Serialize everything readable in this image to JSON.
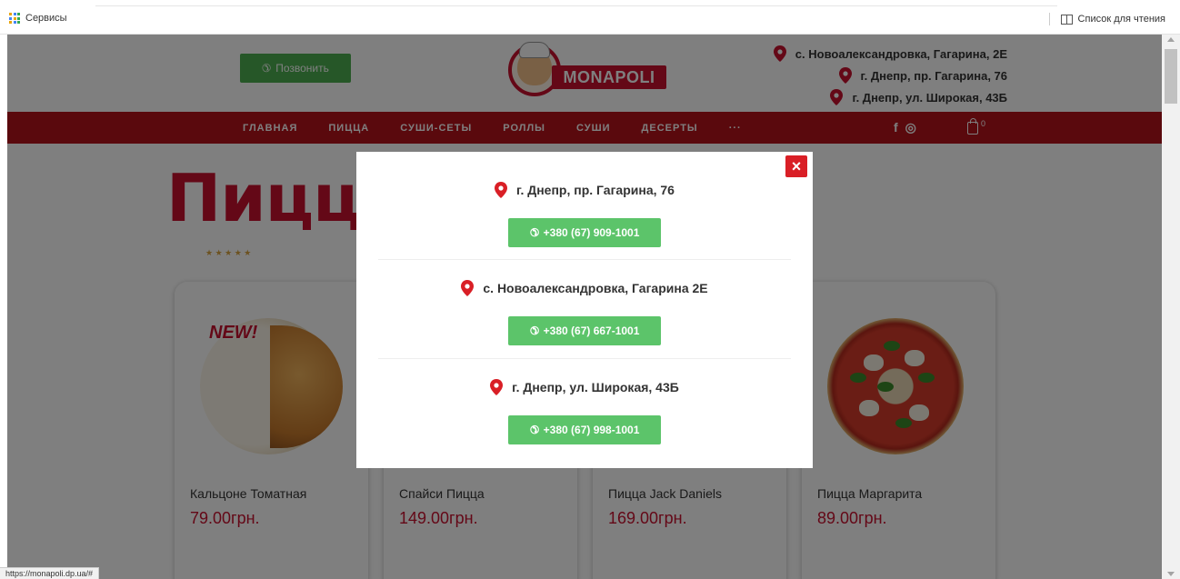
{
  "browser": {
    "bookmarks_label": "Сервисы",
    "reading_list_label": "Список для чтения",
    "status_url": "https://monapoli.dp.ua/#"
  },
  "header": {
    "call_button": "Позвонить",
    "logo_text": "MONAPOLI",
    "addresses": [
      "с. Новоалександровка, Гагарина, 2Е",
      "г. Днепр, пр. Гагарина, 76",
      "г. Днепр, ул. Широкая, 43Б"
    ]
  },
  "nav": {
    "items": [
      "ГЛАВНАЯ",
      "ПИЦЦА",
      "СУШИ-СЕТЫ",
      "РОЛЛЫ",
      "СУШИ",
      "ДЕСЕРТЫ",
      "···"
    ],
    "social": [
      "f",
      "◎"
    ],
    "cart_count": "0"
  },
  "content": {
    "title": "Пицца",
    "stars": "★ ★ ★ ★ ★",
    "new_badge": "NEW!",
    "products": [
      {
        "name": "Кальцоне Томатная",
        "price": "79.00грн."
      },
      {
        "name": "Спайси Пицца",
        "price": "149.00грн."
      },
      {
        "name": "Пицца Jack Daniels",
        "price": "169.00грн."
      },
      {
        "name": "Пицца Маргарита",
        "price": "89.00грн."
      }
    ]
  },
  "modal": {
    "close": "×",
    "branches": [
      {
        "address": "г. Днепр, пр. Гагарина, 76",
        "phone": "+380 (67) 909-1001"
      },
      {
        "address": "с. Новоалександровка, Гагарина 2Е",
        "phone": "+380 (67) 667-1001"
      },
      {
        "address": "г. Днепр, ул. Широкая, 43Б",
        "phone": "+380 (67) 998-1001"
      }
    ]
  },
  "colors": {
    "brand_red": "#b5121b",
    "price_red": "#c8102e",
    "call_green": "#5cc46a"
  }
}
